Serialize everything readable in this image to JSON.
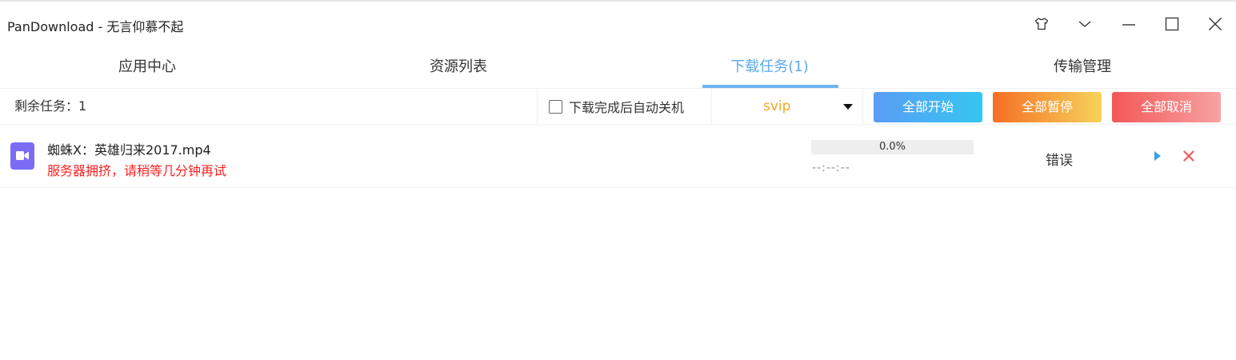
{
  "app": {
    "title": "PanDownload - 无言仰慕不起"
  },
  "window_controls": {
    "skin_icon": "shirt-icon",
    "menu_icon": "chevron-down-icon",
    "minimize_icon": "minimize-icon",
    "maximize_icon": "maximize-icon",
    "close_icon": "close-icon"
  },
  "tabs": [
    {
      "label": "应用中心",
      "active": false
    },
    {
      "label": "资源列表",
      "active": false
    },
    {
      "label": "下载任务(1)",
      "active": true
    },
    {
      "label": "传输管理",
      "active": false
    }
  ],
  "toolbar": {
    "remaining_tasks": "剩余任务：1",
    "auto_shutdown_label": "下载完成后自动关机",
    "auto_shutdown_checked": false,
    "mode_selected": "svip",
    "start_all": "全部开始",
    "pause_all": "全部暂停",
    "cancel_all": "全部取消"
  },
  "tasks": [
    {
      "file_icon": "video-file-icon",
      "name": "蜘蛛X：英雄归来2017.mp4",
      "error": "服务器拥挤，请稍等几分钟再试",
      "progress_value": 0.0,
      "progress_text": "0.0%",
      "time_remaining": "--:--:--",
      "status": "错误",
      "actions": [
        "play-icon",
        "delete-icon"
      ]
    }
  ],
  "colors": {
    "accent": "#5aa9f0",
    "error": "#ff2020",
    "svip": "#f5a623",
    "file_icon": "#7b6cf6"
  }
}
